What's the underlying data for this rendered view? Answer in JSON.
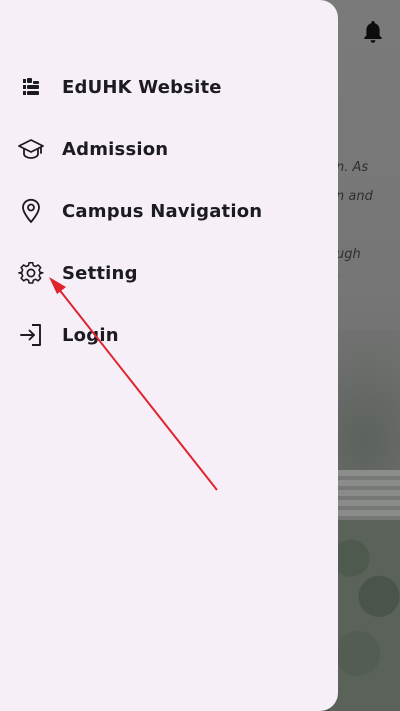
{
  "background": {
    "text_lines": [
      "n. As",
      "n and",
      "ugh",
      "."
    ],
    "notification_icon": "bell-icon"
  },
  "drawer": {
    "items": [
      {
        "label": "EdUHK Website",
        "icon": "website-logo-icon"
      },
      {
        "label": "Admission",
        "icon": "graduation-cap-icon"
      },
      {
        "label": "Campus Navigation",
        "icon": "location-pin-icon"
      },
      {
        "label": "Setting",
        "icon": "gear-icon"
      },
      {
        "label": "Login",
        "icon": "login-icon"
      }
    ]
  },
  "colors": {
    "drawer_bg": "#f6eff8",
    "text": "#1c1b1f",
    "annotation_arrow": "#e0242c"
  }
}
